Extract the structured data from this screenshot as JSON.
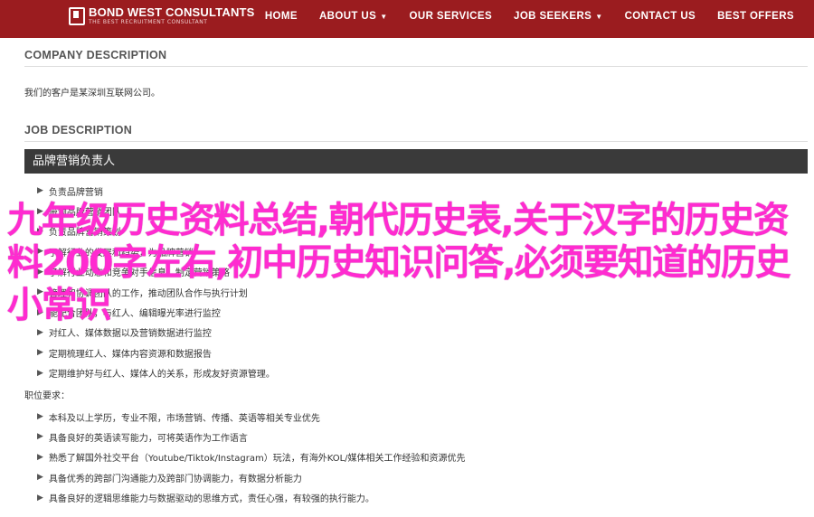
{
  "header": {
    "brand": "BOND WEST CONSULTANTS",
    "tagline": "THE BEST RECRUITMENT CONSULTANT",
    "nav": [
      {
        "label": "HOME"
      },
      {
        "label": "ABOUT US",
        "icon": "chevron-down-icon"
      },
      {
        "label": "OUR SERVICES"
      },
      {
        "label": "JOB SEEKERS",
        "icon": "chevron-down-icon"
      },
      {
        "label": "CONTACT US"
      },
      {
        "label": "BEST OFFERS"
      }
    ],
    "colors": {
      "bar": "#9b1c1f",
      "text": "#ffffff"
    }
  },
  "company": {
    "title": "COMPANY DESCRIPTION",
    "text": "我们的客户是某深圳互联网公司。"
  },
  "job": {
    "title": "JOB DESCRIPTION",
    "role": "品牌营销负责人",
    "responsibilities": [
      "负责品牌营销",
      "带领品牌营销团队",
      "负责品牌营销策划",
      "了解行业的发展和趋势，为品牌营销",
      "了解行业动态和竞争对手信息，制定营销策略",
      "管理和协调团队的工作，推动团队合作与执行计划",
      "能配合团队，与红人、编辑曝光率进行监控",
      "对红人、媒体数据以及营销数据进行监控",
      "定期梳理红人、媒体内容资源和数据报告",
      "定期维护好与红人、媒体人的关系，形成友好资源管理。"
    ],
    "requirements_title": "职位要求：",
    "requirements": [
      "本科及以上学历，专业不限，市场营销、传播、英语等相关专业优先",
      "具备良好的英语读写能力，可将英语作为工作语言",
      "熟悉了解国外社交平台（Youtube/Tiktok/Instagram）玩法，有海外KOL/媒体相关工作经验和资源优先",
      "具备优秀的跨部门沟通能力及跨部门协调能力，有数据分析能力",
      "具备良好的逻辑思维能力与数据驱动的思维方式，责任心强，有较强的执行能力。"
    ]
  },
  "overlay": {
    "text": "九年级历史资料总结,朝代历史表,关于汉字的历史资料200字左右,初中历史知识问答,必须要知道的历史小常识",
    "color": "#ff2bd0"
  }
}
